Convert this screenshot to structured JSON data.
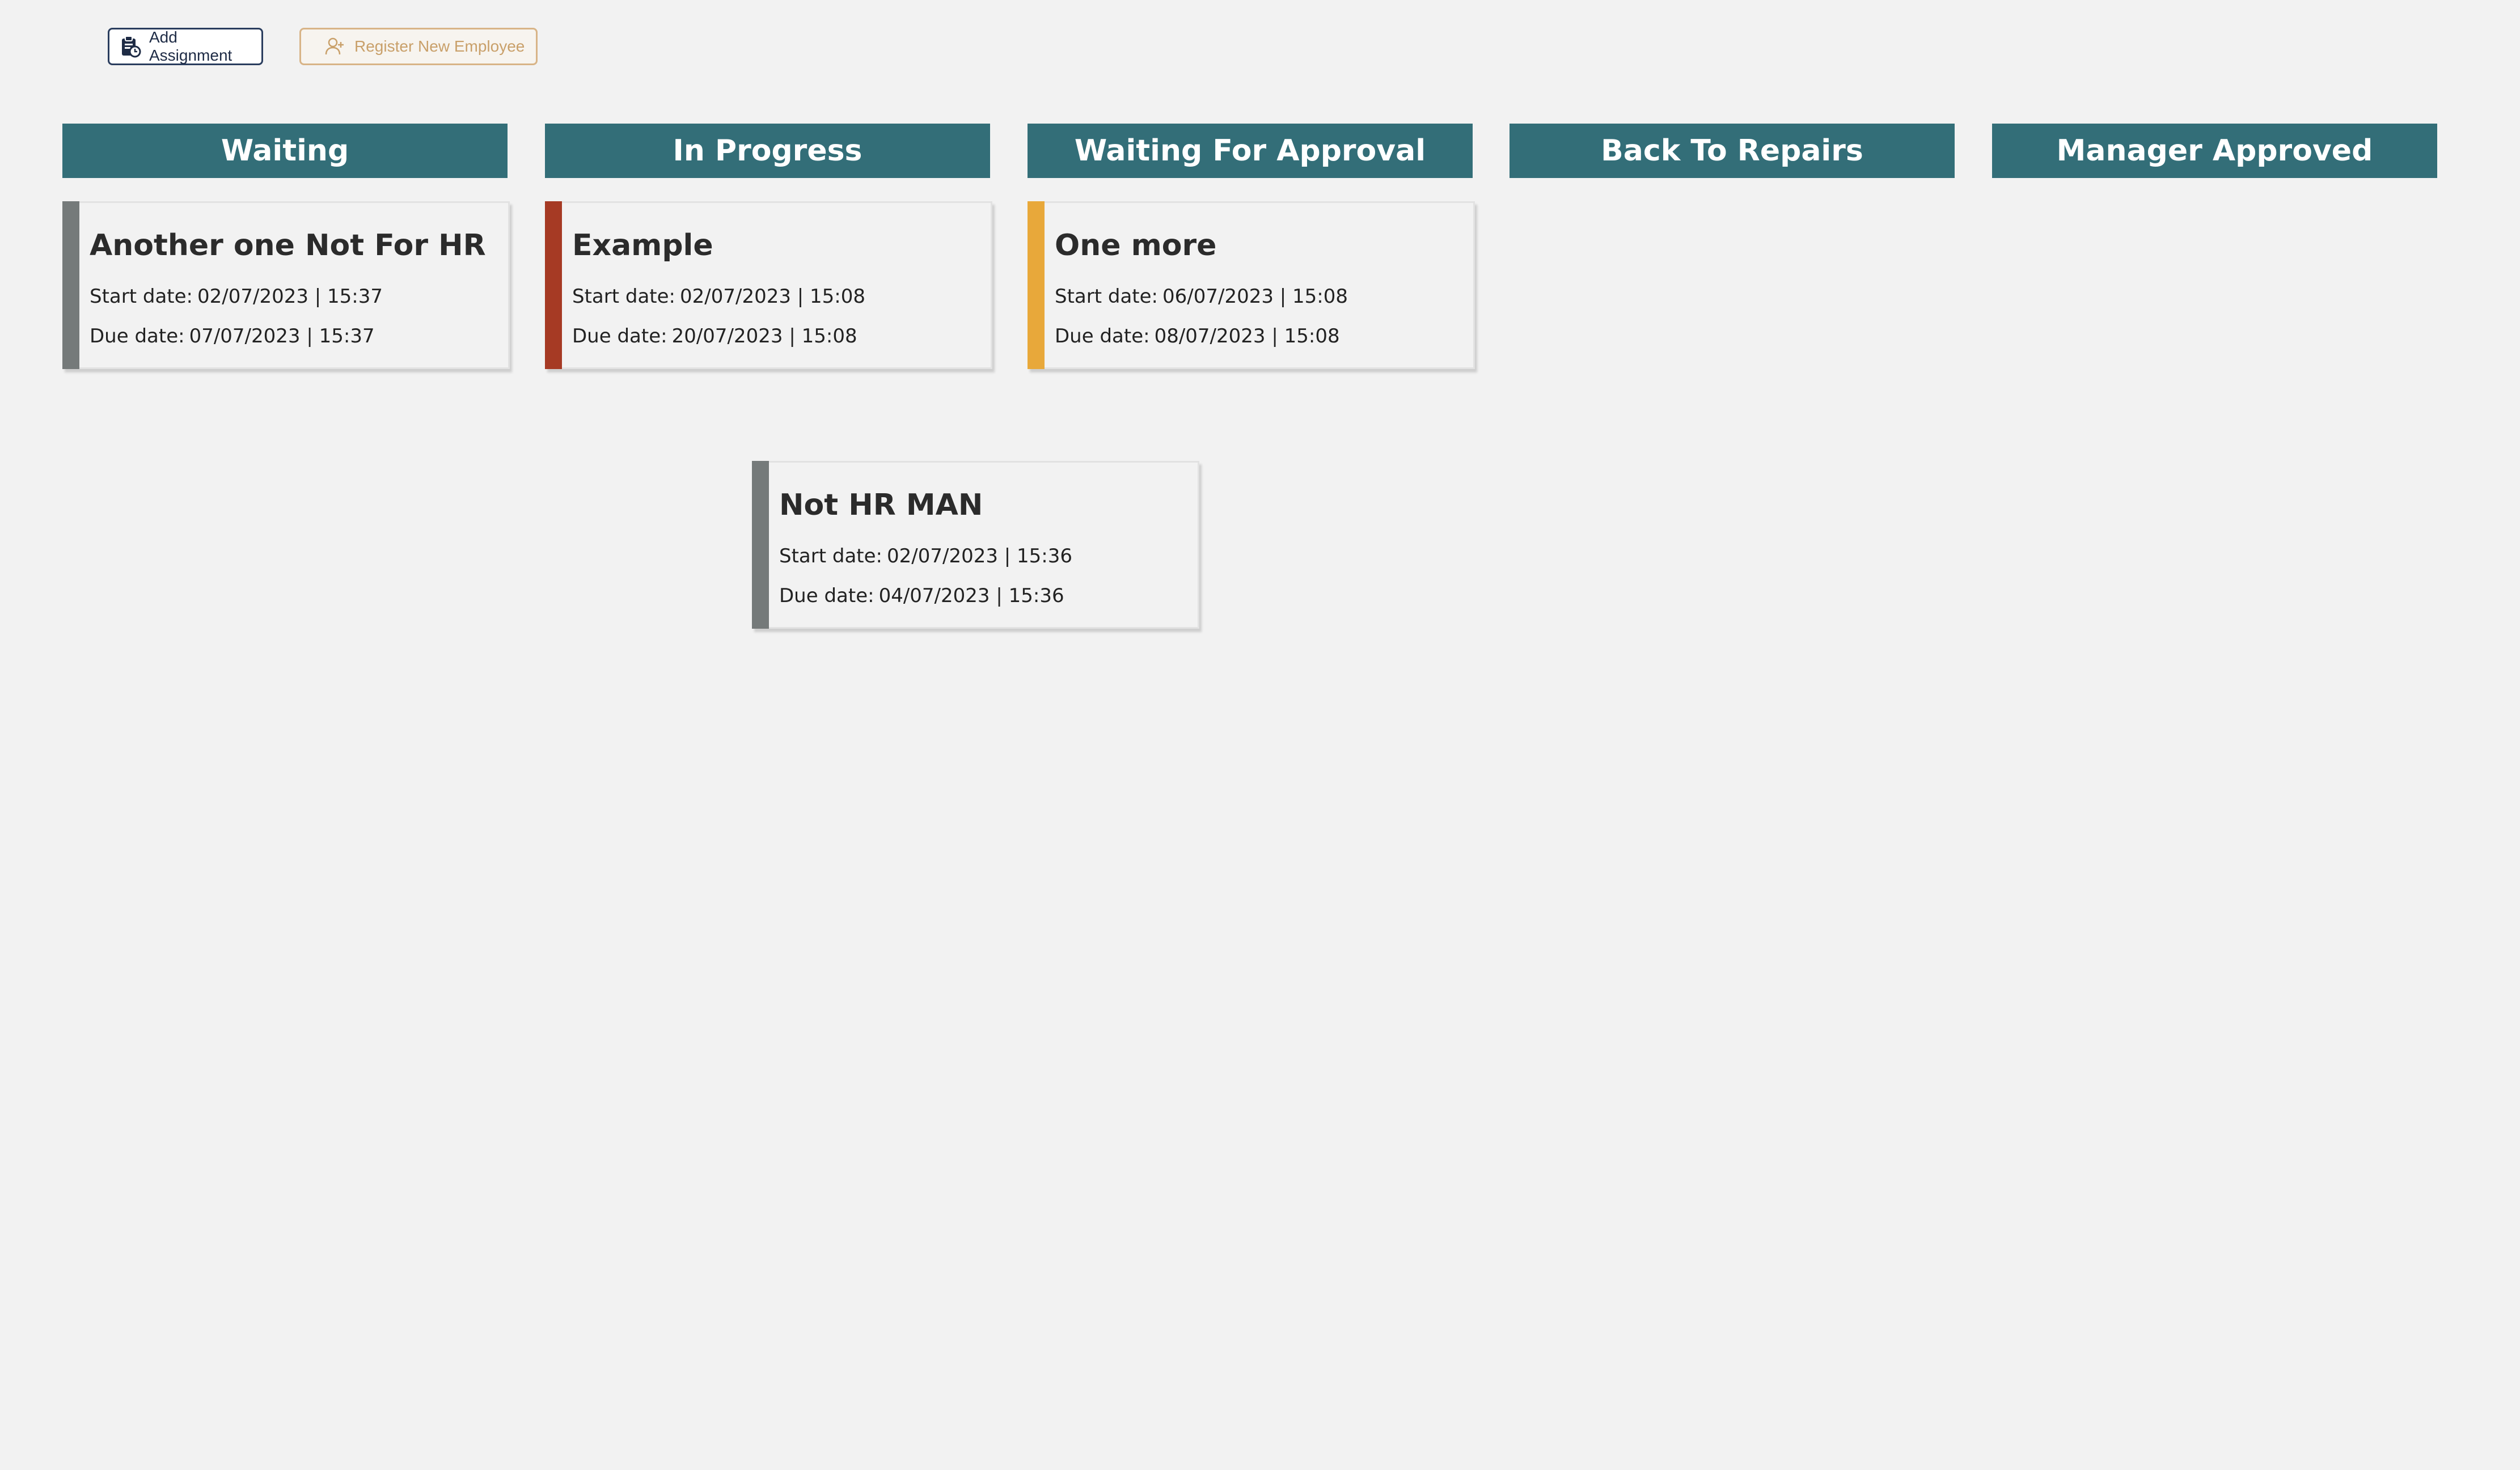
{
  "toolbar": {
    "add_assignment_label": "Add Assignment",
    "add_assignment_icon": "clipboard-clock-icon",
    "register_employee_label": "Register New Employee",
    "register_employee_icon": "user-plus-icon"
  },
  "colors": {
    "header_bg": "#336e78",
    "page_bg": "#f2f2f2",
    "stripe_gray": "#757a7a",
    "stripe_red": "#a63a24",
    "stripe_orange": "#e8a83a"
  },
  "columns": [
    {
      "title": "Waiting"
    },
    {
      "title": "In Progress"
    },
    {
      "title": "Waiting For Approval"
    },
    {
      "title": "Back To Repairs"
    },
    {
      "title": "Manager Approved"
    }
  ],
  "card_labels": {
    "start": "Start date:",
    "due": "Due date:"
  },
  "cards": [
    {
      "column": "Waiting",
      "title": "Another one Not For HR",
      "start": "02/07/2023 | 15:37",
      "due": "07/07/2023 | 15:37",
      "color": "#757a7a"
    },
    {
      "column": "In Progress",
      "title": "Example",
      "start": "02/07/2023 | 15:08",
      "due": "20/07/2023 | 15:08",
      "color": "#a63a24"
    },
    {
      "column": "Waiting For Approval",
      "title": "One more",
      "start": "06/07/2023 | 15:08",
      "due": "08/07/2023 | 15:08",
      "color": "#e8a83a"
    },
    {
      "column": "",
      "title": "Not HR MAN",
      "start": "02/07/2023 | 15:36",
      "due": "04/07/2023 | 15:36",
      "color": "#757a7a"
    }
  ]
}
